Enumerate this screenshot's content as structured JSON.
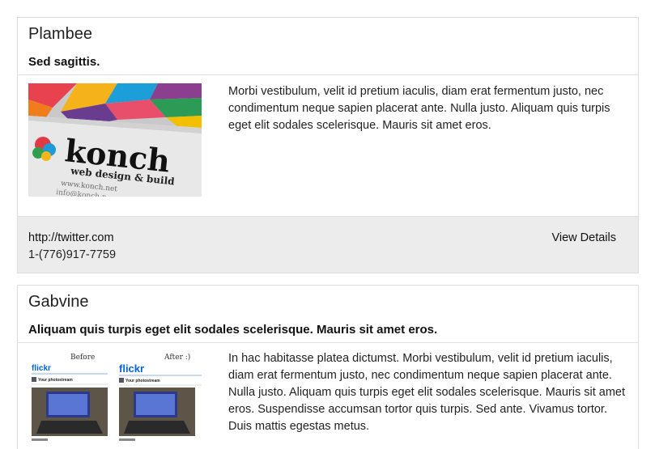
{
  "listings": [
    {
      "title": "Plambee",
      "subtitle": "Sed sagittis.",
      "image_text": {
        "brand": "konch",
        "tagline": "web design & build",
        "url1": "www.konch.net",
        "url2": "info@konch.n"
      },
      "description": "Morbi vestibulum, velit id pretium iaculis, diam erat fermentum justo, nec condimentum neque sapien placerat ante. Nulla justo. Aliquam quis turpis eget elit sodales scelerisque. Mauris sit amet eros.",
      "website": "http://twitter.com",
      "phone": "1-(776)917-7759",
      "details_label": "View Details"
    },
    {
      "title": "Gabvine",
      "subtitle": "Aliquam quis turpis eget elit sodales scelerisque. Mauris sit amet eros.",
      "image_text": {
        "before": "Before",
        "after": "After :)",
        "logo": "flickr",
        "photostream": "Your photostream"
      },
      "description": "In hac habitasse platea dictumst. Morbi vestibulum, velit id pretium iaculis, diam erat fermentum justo, nec condimentum neque sapien placerat ante. Nulla justo. Aliquam quis turpis eget elit sodales scelerisque. Mauris sit amet eros. Suspendisse accumsan tortor quis turpis. Sed ante. Vivamus tortor. Duis mattis egestas metus."
    }
  ]
}
